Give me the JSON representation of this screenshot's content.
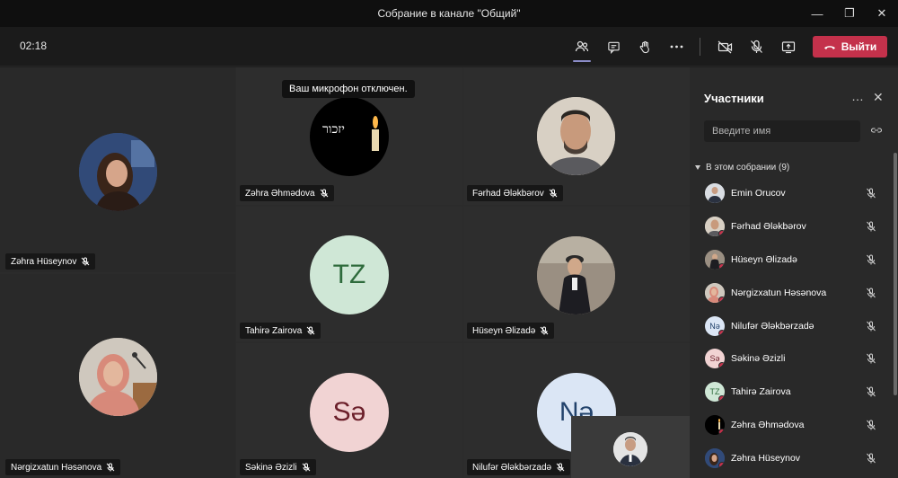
{
  "window": {
    "title": "Собрание в канале \"Общий\""
  },
  "toolbar": {
    "timer": "02:18",
    "leave_label": "Выйти"
  },
  "tooltip": "Ваш микрофон отключен.",
  "tiles": [
    {
      "name": "Zəhra Hüseynov"
    },
    {
      "name": "Zəhra Əhmədova",
      "avatar_text": "יזכור"
    },
    {
      "name": "Fərhad Ələkbərov"
    },
    {
      "name": "Tahirə Zairova",
      "initials": "TZ"
    },
    {
      "name": "Hüseyn Əlizadə"
    },
    {
      "name": "Nərgizxatun Həsənova"
    },
    {
      "name": "Səkinə Əzizli",
      "initials": "Sə"
    },
    {
      "name": "Nilufər Ələkbərzadə",
      "initials": "Nə"
    }
  ],
  "panel": {
    "title": "Участники",
    "search_placeholder": "Введите имя",
    "section_label": "В этом собрании (9)",
    "participants": [
      {
        "name": "Emin Orucov"
      },
      {
        "name": "Fərhad Ələkbərov"
      },
      {
        "name": "Hüseyn Əlizadə"
      },
      {
        "name": "Nərgizxatun Həsənova"
      },
      {
        "name": "Nilufər Ələkbərzadə",
        "initials": "Nə"
      },
      {
        "name": "Səkinə Əzizli",
        "initials": "Sə"
      },
      {
        "name": "Tahirə Zairova",
        "initials": "TZ"
      },
      {
        "name": "Zəhra Əhmədova"
      },
      {
        "name": "Zəhra Hüseynov"
      }
    ]
  },
  "colors": {
    "leave": "#c4314b",
    "accent": "#8b8cc7",
    "tz_bg": "#cfe7d6",
    "tz_fg": "#2e6b3c",
    "se_bg": "#f1d3d3",
    "se_fg": "#6b1f2a",
    "ne_bg": "#dbe6f5",
    "ne_fg": "#22426b"
  }
}
